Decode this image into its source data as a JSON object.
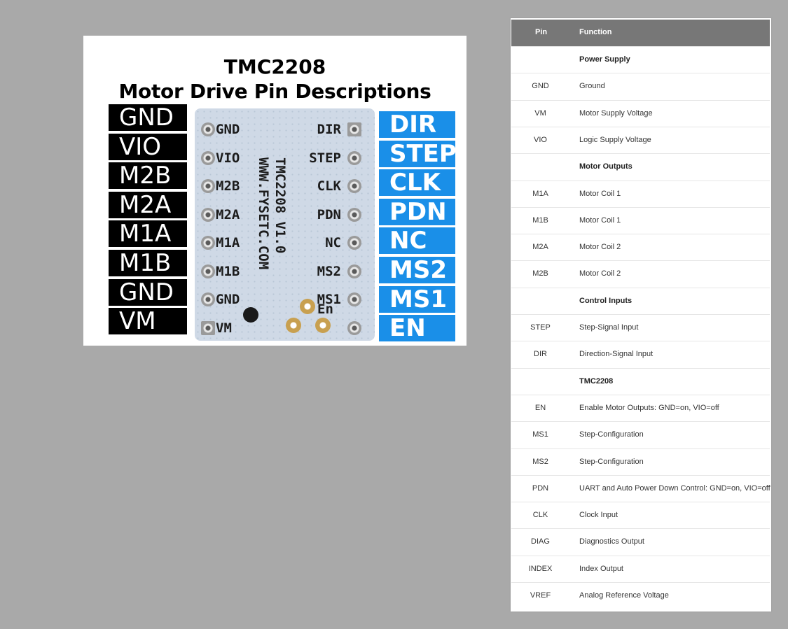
{
  "diagram": {
    "title_line1": "TMC2208",
    "title_line2": "Motor Drive Pin Descriptions",
    "left_labels": [
      "GND",
      "VIO",
      "M2B",
      "M2A",
      "M1A",
      "M1B",
      "GND",
      "VM"
    ],
    "right_labels": [
      "DIR",
      "STEP",
      "CLK",
      "PDN",
      "NC",
      "MS2",
      "MS1",
      "EN"
    ],
    "board_left_silk": [
      "GND",
      "VIO",
      "M2B",
      "M2A",
      "M1A",
      "M1B",
      "GND",
      "VM"
    ],
    "board_right_silk": [
      "DIR",
      "STEP",
      "CLK",
      "PDN",
      "NC",
      "MS2",
      "MS1"
    ],
    "board_en_silk": "En",
    "board_vertical_1": "TMC2208 V1.0",
    "board_vertical_2": "WWW.FYSETC.COM",
    "colors": {
      "left_label_bg": "#000000",
      "right_label_bg": "#1a8fe8"
    }
  },
  "table": {
    "header": {
      "pin": "Pin",
      "function": "Function"
    },
    "rows": [
      {
        "pin": "",
        "function": "Power Supply",
        "section": true
      },
      {
        "pin": "GND",
        "function": "Ground"
      },
      {
        "pin": "VM",
        "function": "Motor Supply Voltage"
      },
      {
        "pin": "VIO",
        "function": "Logic Supply Voltage"
      },
      {
        "pin": "",
        "function": "Motor Outputs",
        "section": true
      },
      {
        "pin": "M1A",
        "function": "Motor Coil 1"
      },
      {
        "pin": "M1B",
        "function": "Motor Coil 1"
      },
      {
        "pin": "M2A",
        "function": "Motor Coil 2"
      },
      {
        "pin": "M2B",
        "function": "Motor Coil 2"
      },
      {
        "pin": "",
        "function": "Control Inputs",
        "section": true
      },
      {
        "pin": "STEP",
        "function": "Step-Signal Input"
      },
      {
        "pin": "DIR",
        "function": "Direction-Signal Input"
      },
      {
        "pin": "",
        "function": "TMC2208",
        "section": true
      },
      {
        "pin": "EN",
        "function": "Enable Motor Outputs: GND=on, VIO=off"
      },
      {
        "pin": "MS1",
        "function": "Step-Configuration"
      },
      {
        "pin": "MS2",
        "function": "Step-Configuration"
      },
      {
        "pin": "PDN",
        "function": "UART and Auto Power Down Control: GND=on, VIO=off"
      },
      {
        "pin": "CLK",
        "function": "Clock Input"
      },
      {
        "pin": "DIAG",
        "function": "Diagnostics Output"
      },
      {
        "pin": "INDEX",
        "function": "Index Output"
      },
      {
        "pin": "VREF",
        "function": "Analog Reference Voltage"
      }
    ]
  }
}
